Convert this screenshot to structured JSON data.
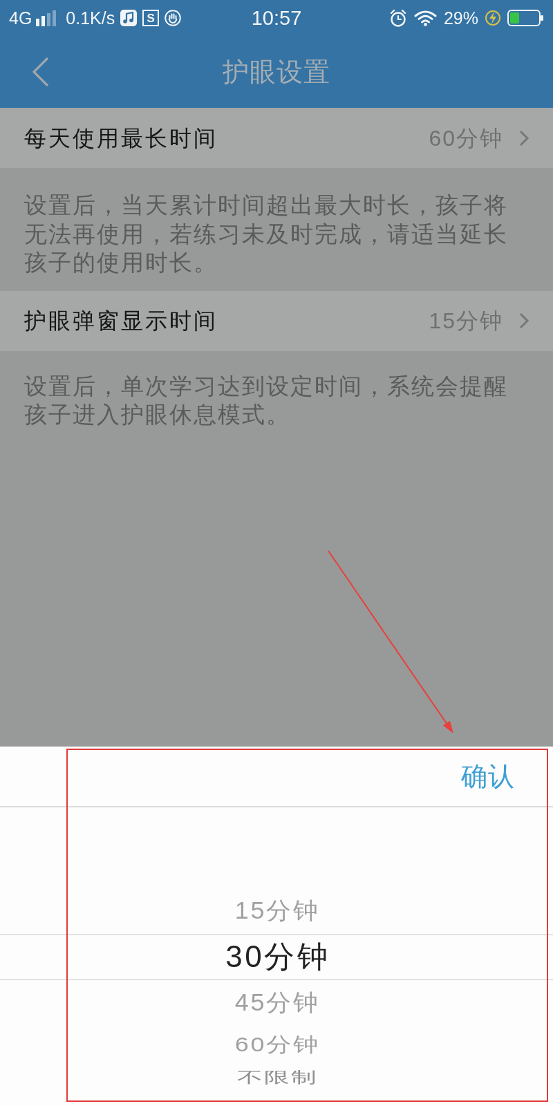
{
  "status_bar": {
    "network": "4G",
    "speed": "0.1K/s",
    "app_letter": "S",
    "time": "10:57",
    "battery": "29%"
  },
  "nav_bar": {
    "title": "护眼设置"
  },
  "settings": [
    {
      "label": "每天使用最长时间",
      "value": "60分钟",
      "description": "设置后，当天累计时间超出最大时长，孩子将无法再使用，若练习未及时完成，请适当延长孩子的使用时长。"
    },
    {
      "label": "护眼弹窗显示时间",
      "value": "15分钟",
      "description": "设置后，单次学习达到设定时间，系统会提醒孩子进入护眼休息模式。"
    }
  ],
  "picker": {
    "confirm": "确认",
    "options": [
      {
        "label": "15分钟",
        "selected": false
      },
      {
        "label": "30分钟",
        "selected": true
      },
      {
        "label": "45分钟",
        "selected": false
      },
      {
        "label": "60分钟",
        "selected": false
      },
      {
        "label": "不限制",
        "selected": false
      }
    ]
  },
  "annotation": {
    "frame": true,
    "arrow": true
  }
}
